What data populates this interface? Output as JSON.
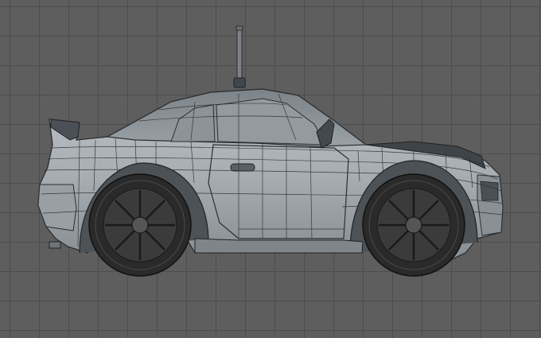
{
  "viewport": {
    "view": "side",
    "object": "car",
    "display_mode": "wireframe-on-shaded",
    "grid": true
  },
  "colors": {
    "background": "#5e5e5e",
    "grid_line": "#4d4d4d",
    "body_fill": "#a9afb4",
    "body_shadow": "#8e959a",
    "wire": "#2b2f33",
    "tire": "#2a2a2a",
    "rim": "#3b3b3b",
    "window": "#8f979c"
  },
  "icons": [
    "antenna-icon",
    "side-mirror-icon",
    "door-handle-icon",
    "wheel-icon"
  ]
}
